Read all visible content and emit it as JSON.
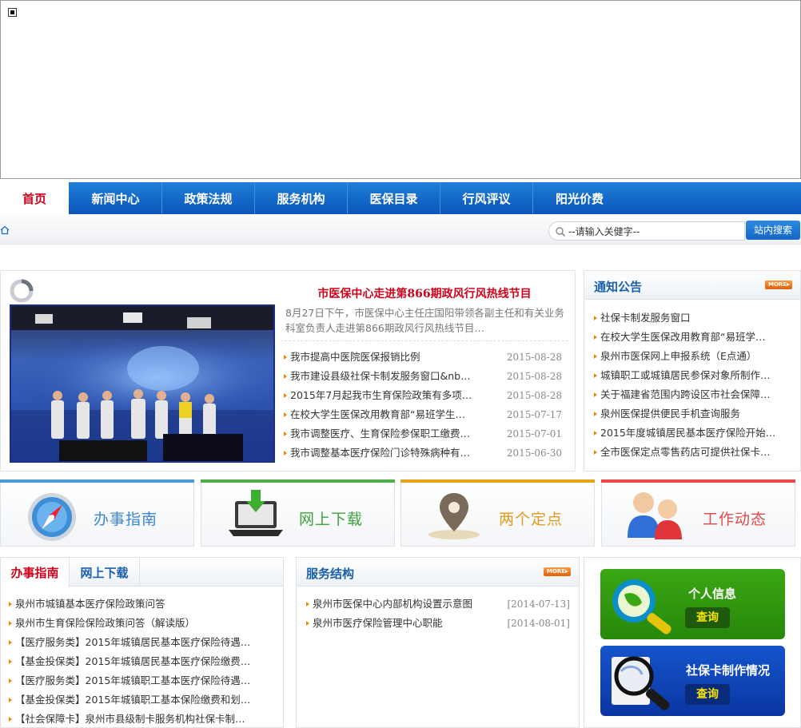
{
  "nav": {
    "items": [
      "首页",
      "新闻中心",
      "政策法规",
      "服务机构",
      "医保目录",
      "行风评议",
      "阳光价费"
    ]
  },
  "search": {
    "value": "--请输入关健字--",
    "button": "站内搜索"
  },
  "news": {
    "headline": "市医保中心走进第866期政风行风热线节目",
    "summary": "8月27日下午，市医保中心主任庄国阳带领各副主任和有关业务科室负责人走进第866期政风行风热线节目…",
    "items": [
      {
        "title": "我市提高中医院医保报销比例",
        "date": "2015-08-28"
      },
      {
        "title": "我市建设县级社保卡制发服务窗口&nbs…",
        "date": "2015-08-28"
      },
      {
        "title": "2015年7月起我市生育保险政策有多项…",
        "date": "2015-08-28"
      },
      {
        "title": "在校大学生医保改用教育部“易班学生…",
        "date": "2015-07-17"
      },
      {
        "title": "我市调整医疗、生育保险参保职工缴费…",
        "date": "2015-07-01"
      },
      {
        "title": "我市调整基本医疗保险门诊特殊病种有…",
        "date": "2015-06-30"
      }
    ]
  },
  "notice": {
    "title": "通知公告",
    "more": "MORE",
    "items": [
      "社保卡制发服务窗口",
      "在校大学生医保改用教育部“易班学…",
      "泉州市医保网上申报系统（E点通）",
      "城镇职工或城镇居民参保对象所制作…",
      "关于福建省范围内跨设区市社会保障…",
      "泉州医保提供便民手机查询服务",
      "2015年度城镇居民基本医疗保险开始…",
      "全市医保定点零售药店可提供社保卡…"
    ]
  },
  "tiles": [
    {
      "label": "办事指南",
      "color": "#4a9ad8"
    },
    {
      "label": "网上下载",
      "color": "#4bb04a"
    },
    {
      "label": "两个定点",
      "color": "#e8a21c"
    },
    {
      "label": "工作动态",
      "color": "#e8484c"
    }
  ],
  "guide": {
    "tabs": [
      "办事指南",
      "网上下载"
    ],
    "items": [
      "泉州市城镇基本医疗保险政策问答",
      "泉州市生育保险保险政策问答（解读版）",
      "【医疗服务类】2015年城镇居民基本医疗保险待遇…",
      "【基金投保类】2015年城镇居民基本医疗保险缴费…",
      "【医疗服务类】2015年城镇职工基本医疗保险待遇…",
      "【基金投保类】2015年城镇职工基本保险缴费和划…",
      "【社会保障卡】泉州市县级制卡服务机构社保卡制…"
    ]
  },
  "service": {
    "title": "服务结构",
    "more": "MORE",
    "items": [
      {
        "title": "泉州市医保中心内部机构设置示意图",
        "date": "[2014-07-13]"
      },
      {
        "title": "泉州市医疗保险管理中心职能",
        "date": "[2014-08-01]"
      }
    ]
  },
  "query": [
    {
      "title": "个人信息",
      "button": "查询",
      "color": "#2e9a0f"
    },
    {
      "title": "社保卡制作情况",
      "button": "查询",
      "color": "#0d3fb0"
    }
  ]
}
